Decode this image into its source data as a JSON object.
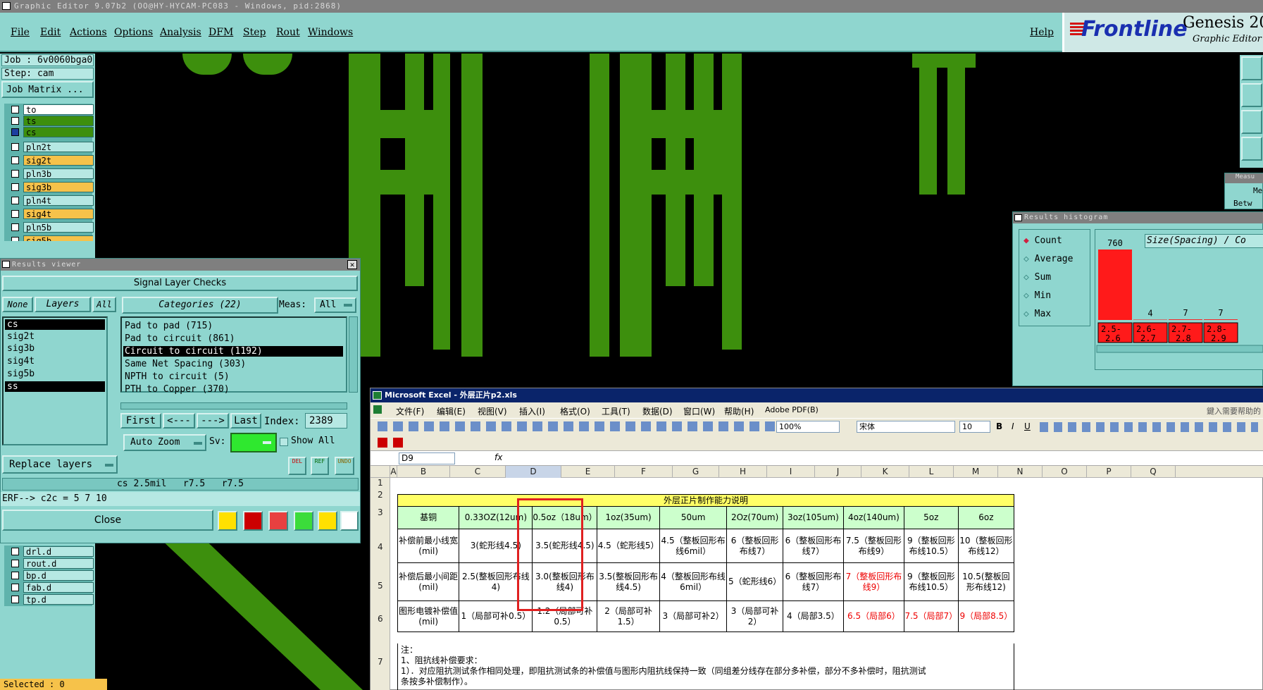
{
  "window": {
    "title": "Graphic Editor 9.07b2  (OO@HY-HYCAM-PC083 - Windows, pid:2868)"
  },
  "menu": {
    "file": "File",
    "edit": "Edit",
    "actions": "Actions",
    "options": "Options",
    "analysis": "Analysis",
    "dfm": "DFM",
    "step": "Step",
    "rout": "Rout",
    "windows": "Windows",
    "help": "Help"
  },
  "logo": {
    "brand": "Frontline",
    "product": "Genesis 200",
    "subtitle": "Graphic Editor"
  },
  "job": {
    "job_label": "Job : 6v0060bga0",
    "step_label": "Step: cam",
    "matrix_button": "Job Matrix ..."
  },
  "layers": {
    "top": [
      "to",
      "ts",
      "cs",
      "pln2t",
      "sig2t",
      "pln3b",
      "sig3b",
      "pln4t",
      "sig4t",
      "pln5b",
      "sig5b"
    ],
    "bottom": [
      "drl.d",
      "rout.d",
      "bp.d",
      "fab.d",
      "tp.d"
    ],
    "selected_count": "Selected : 0"
  },
  "results_viewer": {
    "title": "Results viewer",
    "header": "Signal Layer Checks",
    "none": "None",
    "layers": "Layers",
    "all": "All",
    "categories": "Categories (22)",
    "meas_label": "Meas:",
    "meas_value": "All",
    "layer_list": [
      "cs",
      "sig2t",
      "sig3b",
      "sig4t",
      "sig5b",
      "ss"
    ],
    "category_list": [
      "Pad to pad (715)",
      "Pad to circuit (861)",
      "Circuit to circuit (1192)",
      "Same Net Spacing (303)",
      "NPTH to circuit (5)",
      "PTH to Copper (370)"
    ],
    "first": "First",
    "prev": "<---",
    "next": "--->",
    "last": "Last",
    "index_label": "Index:",
    "index_value": "2389",
    "auto_zoom": "Auto Zoom",
    "sv_label": "Sv:",
    "show_all": "Show All",
    "replace_layers": "Replace layers",
    "status": "cs 2.5mil   r7.5   r7.5",
    "erf": "ERF--> c2c = 5 7 10",
    "close": "Close"
  },
  "histogram": {
    "title": "Results histogram",
    "modes": [
      "Count",
      "Average",
      "Sum",
      "Min",
      "Max"
    ],
    "chart_title": "Size(Spacing) / Co"
  },
  "chart_data": {
    "type": "bar",
    "categories": [
      "2.5-2.6",
      "2.6-2.7",
      "2.7-2.8",
      "2.8-2.9"
    ],
    "values": [
      760,
      4,
      7,
      7
    ],
    "xlabel": "",
    "ylabel": "",
    "colors": {
      "bar": "#ff1a1a"
    }
  },
  "measure": {
    "title": "Measu",
    "label1": "Mea",
    "label2": "Betw"
  },
  "excel": {
    "title": "Microsoft Excel - 外层正片p2.xls",
    "menus": [
      "文件(F)",
      "编辑(E)",
      "视图(V)",
      "插入(I)",
      "格式(O)",
      "工具(T)",
      "数据(D)",
      "窗口(W)",
      "帮助(H)",
      "Adobe PDF(B)"
    ],
    "help_hint": "鍵入需要帮助的",
    "zoom": "100%",
    "font_name": "宋体",
    "font_size": "10",
    "cell_ref": "D9",
    "fx": "fx",
    "columns": [
      "A",
      "B",
      "C",
      "D",
      "E",
      "F",
      "G",
      "H",
      "I",
      "J",
      "K",
      "L",
      "M",
      "N",
      "O",
      "P",
      "Q"
    ],
    "rows": [
      "1",
      "2",
      "3",
      "4",
      "5",
      "6",
      "7"
    ],
    "table_title": "外层正片制作能力说明",
    "header": [
      "基铜",
      "0.33OZ(12um)",
      "0.5oz（18um）",
      "1oz(35um)",
      "50um",
      "2Oz(70um)",
      "3oz(105um)",
      "4oz(140um)",
      "5oz",
      "6oz"
    ],
    "row4": [
      "补偿前最小线宽(mil)",
      "3(蛇形线4.5)",
      "3.5(蛇形线4.5)",
      "4.5（蛇形线5）",
      "4.5（整板回形布线6mil）",
      "6（整板回形布线7）",
      "6（整板回形布线7）",
      "7.5（整板回形布线9）",
      "9（整板回形布线10.5）",
      "10（整板回形布线12）"
    ],
    "row5": [
      "补偿后最小间距(mil)",
      "2.5(整板回形布线4)",
      "3.0(整板回形布线4)",
      "3.5(整板回形布线4.5)",
      "4（整板回形布线6mil）",
      "5（蛇形线6）",
      "6（整板回形布线7）",
      "7（整板回形布线9）",
      "9（整板回形布线10.5）",
      "10.5(整板回形布线12)"
    ],
    "row6": [
      "图形电镀补偿值(mil)",
      "1（局部可补0.5）",
      "1.2（局部可补0.5）",
      "2（局部可补1.5）",
      "3（局部可补2）",
      "3（局部可补2）",
      "4（局部3.5）",
      "6.5（局部6）",
      "7.5（局部7）",
      "9（局部8.5）"
    ],
    "note1": "注：",
    "note2": "1、阻抗线补偿要求：",
    "note3": "1）．对应阻抗测试条作相同处理，即阻抗测试条的补偿值与图形内阻抗线保持一致（同组差分线存在部分多补偿，部分不多补偿时，阻抗测试",
    "note4": "条按多补偿制作）。"
  },
  "colors": {
    "pcb_copper": "#3d8f0d",
    "gui_teal": "#8fd6cf",
    "highlight_red": "#e02020"
  }
}
